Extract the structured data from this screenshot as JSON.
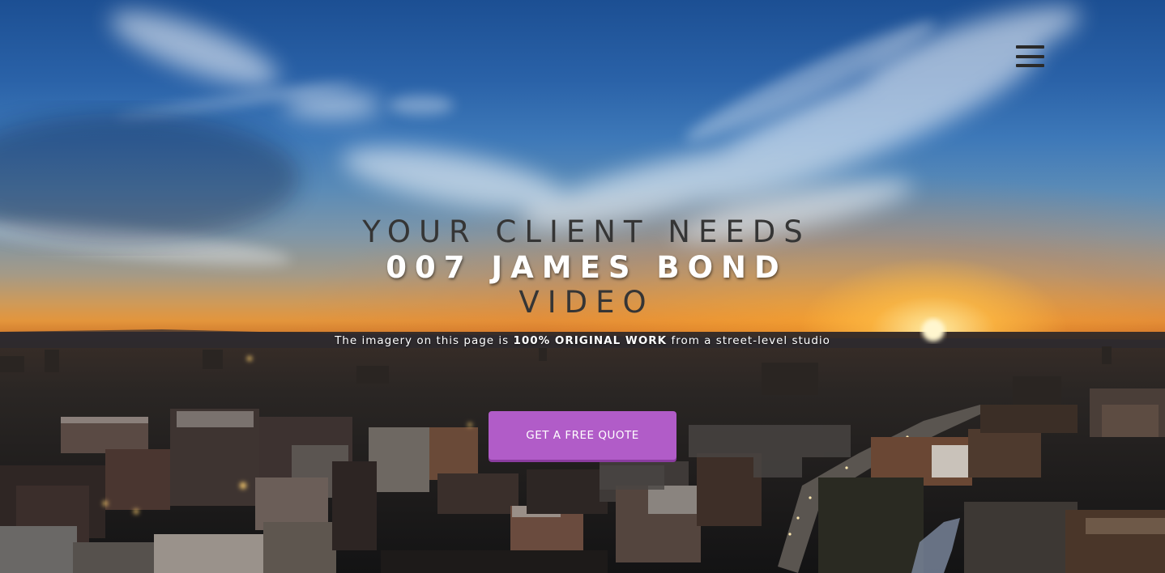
{
  "nav": {
    "menu_icon": "hamburger-menu-icon"
  },
  "hero": {
    "line1": "YOUR CLIENT NEEDS",
    "line2": "007 JAMES BOND",
    "line3": "VIDEO",
    "subline_before": "The imagery on this page is ",
    "subline_bold": "100% ORIGINAL WORK",
    "subline_after": " from a street-level studio",
    "cta_label": "GET A FREE QUOTE"
  },
  "colors": {
    "cta_background": "#b15cc8",
    "headline_dark": "#353535",
    "headline_light": "#ffffff",
    "menu_icon": "#2a2a2a"
  }
}
